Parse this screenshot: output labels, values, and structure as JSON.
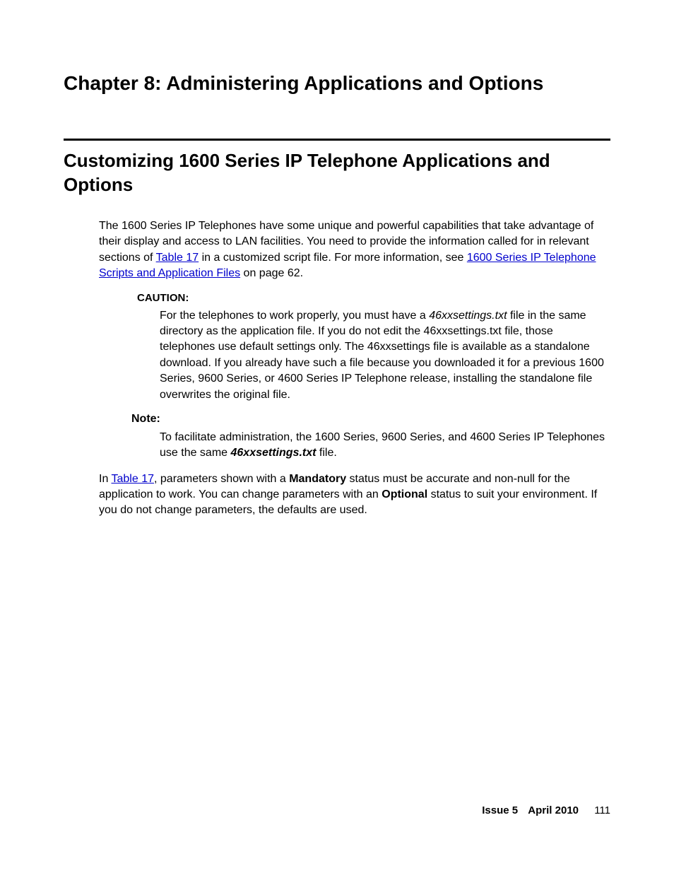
{
  "chapter_title": "Chapter 8:   Administering Applications and Options",
  "section_title": "Customizing 1600 Series IP Telephone Applications and Options",
  "intro_1": "The 1600 Series IP Telephones have some unique and powerful capabilities that take advantage of their display and access to LAN facilities. You need to provide the information called for in relevant sections of ",
  "intro_link1": "Table 17",
  "intro_2": " in a customized script file. For more information, see ",
  "intro_link2": "1600 Series IP Telephone Scripts and Application Files",
  "intro_3": " on page 62.",
  "caution_label": "CAUTION:",
  "caution_pre": "For the telephones to work properly, you must have a ",
  "caution_file": "46xxsettings.txt",
  "caution_post": " file in the same directory as the application file. If you do not edit the 46xxsettings.txt file, those telephones use default settings only. The 46xxsettings file is available as a standalone download. If you already have such a file because you downloaded it for a previous 1600 Series, 9600 Series, or 4600 Series IP Telephone release, installing the standalone file overwrites the original file.",
  "note_label": "Note:",
  "note_pre": "To facilitate administration, the 1600 Series, 9600 Series, and 4600 Series IP Telephones use the same ",
  "note_file": "46xxsettings.txt",
  "note_post": " file.",
  "para2_1": "In ",
  "para2_link": "Table 17",
  "para2_2": ", parameters shown with a ",
  "para2_mand": "Mandatory",
  "para2_3": " status must be accurate and non-null for the application to work. You can change parameters with an ",
  "para2_opt": "Optional",
  "para2_4": " status to suit your environment. If you do not change parameters, the defaults are used.",
  "footer_issue": "Issue 5",
  "footer_date": "April 2010",
  "footer_page": "111"
}
